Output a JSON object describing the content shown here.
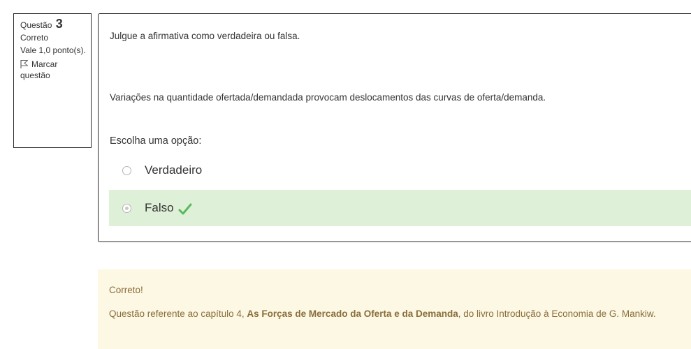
{
  "info": {
    "question_label": "Questão",
    "question_number": "3",
    "state": "Correto",
    "grade": "Vale 1,0 ponto(s).",
    "flag_label_1": "Marcar",
    "flag_label_2": "questão"
  },
  "question": {
    "prompt": "Julgue a afirmativa como verdadeira ou falsa.",
    "statement": "Variações na quantidade ofertada/demandada provocam deslocamentos das curvas de oferta/demanda.",
    "choose_label": "Escolha uma opção:",
    "options": [
      {
        "label": "Verdadeiro",
        "selected": false
      },
      {
        "label": "Falso",
        "selected": true,
        "correct": true
      }
    ]
  },
  "feedback": {
    "result": "Correto!",
    "text_before": "Questão referente ao capítulo 4, ",
    "text_bold": "As Forças de Mercado da Oferta e da Demanda",
    "text_after": ", do livro Introdução à Economia de G. Mankiw."
  },
  "colors": {
    "correct_bg": "#dff0d8",
    "feedback_bg": "#fcf8e3",
    "feedback_text": "#8a6d3b",
    "check": "#5cb85c"
  }
}
